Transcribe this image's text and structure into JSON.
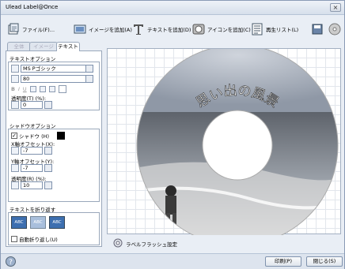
{
  "window": {
    "title": "Ulead Label@Once",
    "close_label": "×"
  },
  "toolbar": {
    "file": "ファイル(F)...",
    "add_image": "イメージを追加(A)",
    "add_text": "テキストを追加(D)",
    "add_icon": "アイコンを追加(C)",
    "playlist": "再生リスト(L)"
  },
  "tabs": {
    "tab1": "全体",
    "tab2": "イメージ",
    "tab3": "テキスト"
  },
  "text_options": {
    "header": "テキストオプション",
    "font": "MS Pゴシック",
    "size": "80",
    "opacity_label": "透明度(T) (%):",
    "opacity_value": "0"
  },
  "shadow_options": {
    "header": "シャドウオプション",
    "shadow_label": "シャドウ (H)",
    "x_offset_label": "X軸オフセット(X):",
    "x_offset_value": "-7",
    "y_offset_label": "Y軸オフセット(Y):",
    "y_offset_value": "-7",
    "opacity_label": "透明度(R) (%):",
    "opacity_value": "10"
  },
  "wrap": {
    "header": "テキストを折り返す",
    "abc1": "ABC",
    "abc2": "ABC",
    "abc3": "ABC",
    "auto_wrap": "自動折り返し(U)"
  },
  "disc": {
    "title_text": "思い出の風景"
  },
  "label_flash": "ラベルフラッシュ設定",
  "footer": {
    "print": "印刷(P)",
    "close": "閉じる(S)"
  },
  "colors": {
    "shadow_swatch": "#000000",
    "accent": "#3d6fb0"
  }
}
